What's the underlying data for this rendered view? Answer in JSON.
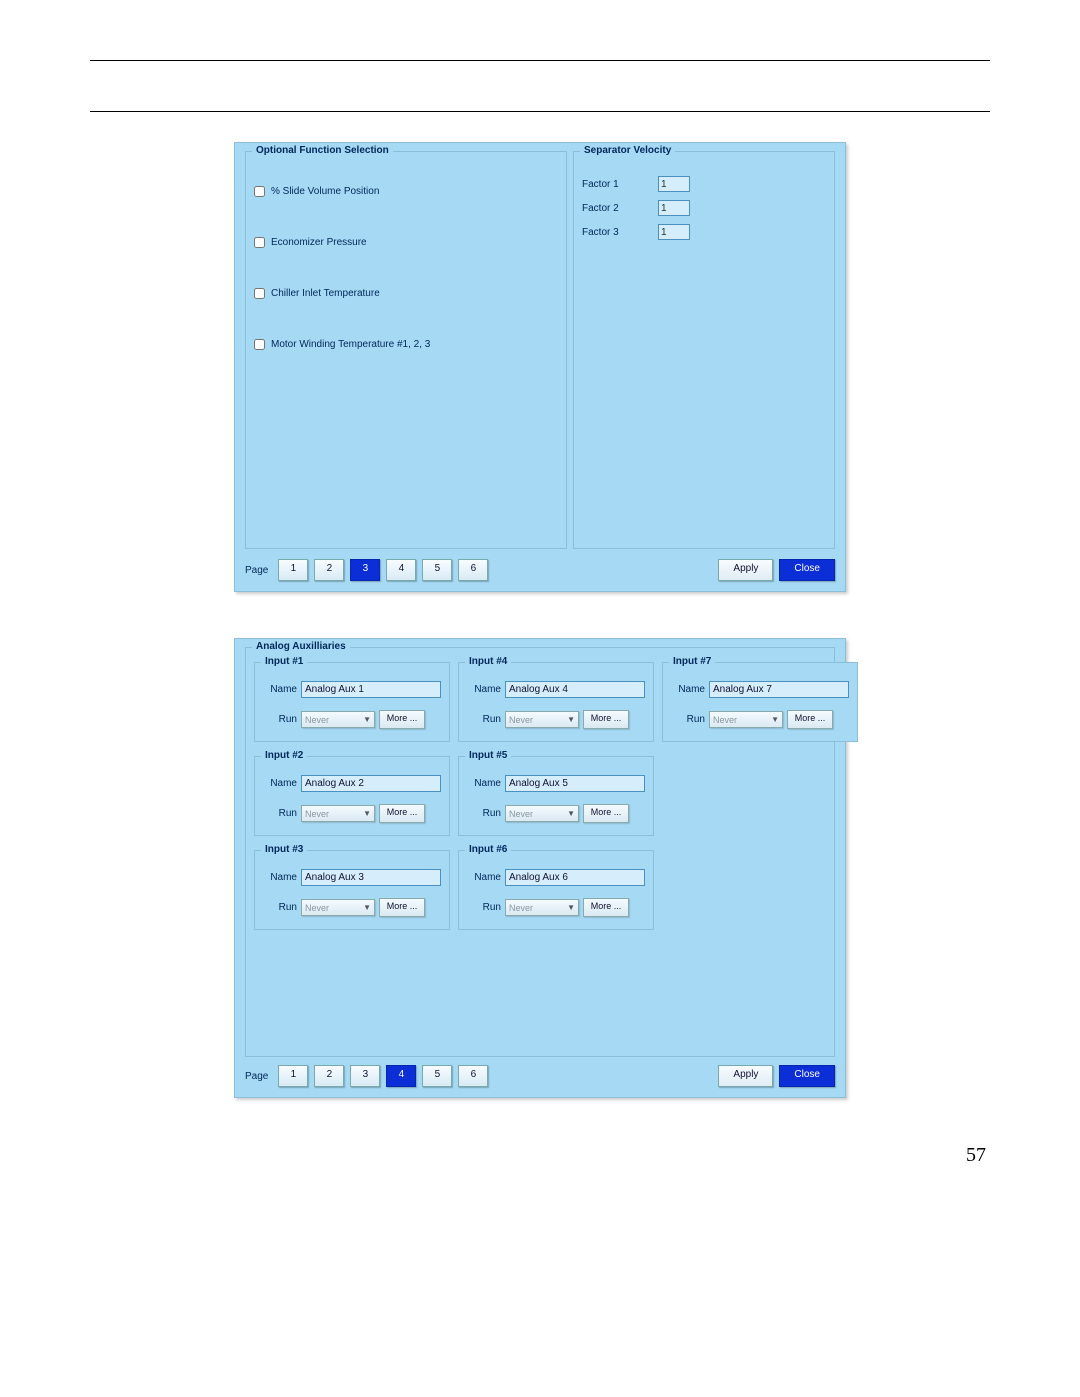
{
  "pageNumber": "57",
  "panel1": {
    "optionalFunction": {
      "legend": "Optional Function Selection",
      "items": [
        "% Slide Volume Position",
        "Economizer Pressure",
        "Chiller Inlet Temperature",
        "Motor Winding Temperature #1, 2, 3"
      ]
    },
    "separatorVelocity": {
      "legend": "Separator Velocity",
      "rows": [
        {
          "label": "Factor 1",
          "value": "1"
        },
        {
          "label": "Factor 2",
          "value": "1"
        },
        {
          "label": "Factor 3",
          "value": "1"
        }
      ]
    },
    "pager": {
      "label": "Page",
      "pages": [
        "1",
        "2",
        "3",
        "4",
        "5",
        "6"
      ],
      "selected": "3",
      "apply": "Apply",
      "close": "Close"
    }
  },
  "panel2": {
    "legend": "Analog Auxilliaries",
    "nameLabel": "Name",
    "runLabel": "Run",
    "runValue": "Never",
    "moreLabel": "More ...",
    "inputs": [
      {
        "title": "Input #1",
        "name": "Analog Aux 1"
      },
      {
        "title": "Input #2",
        "name": "Analog Aux 2"
      },
      {
        "title": "Input #3",
        "name": "Analog Aux 3"
      },
      {
        "title": "Input #4",
        "name": "Analog Aux 4"
      },
      {
        "title": "Input #5",
        "name": "Analog Aux 5"
      },
      {
        "title": "Input #6",
        "name": "Analog Aux 6"
      },
      {
        "title": "Input #7",
        "name": "Analog Aux 7"
      }
    ],
    "pager": {
      "label": "Page",
      "pages": [
        "1",
        "2",
        "3",
        "4",
        "5",
        "6"
      ],
      "selected": "4",
      "apply": "Apply",
      "close": "Close"
    }
  }
}
